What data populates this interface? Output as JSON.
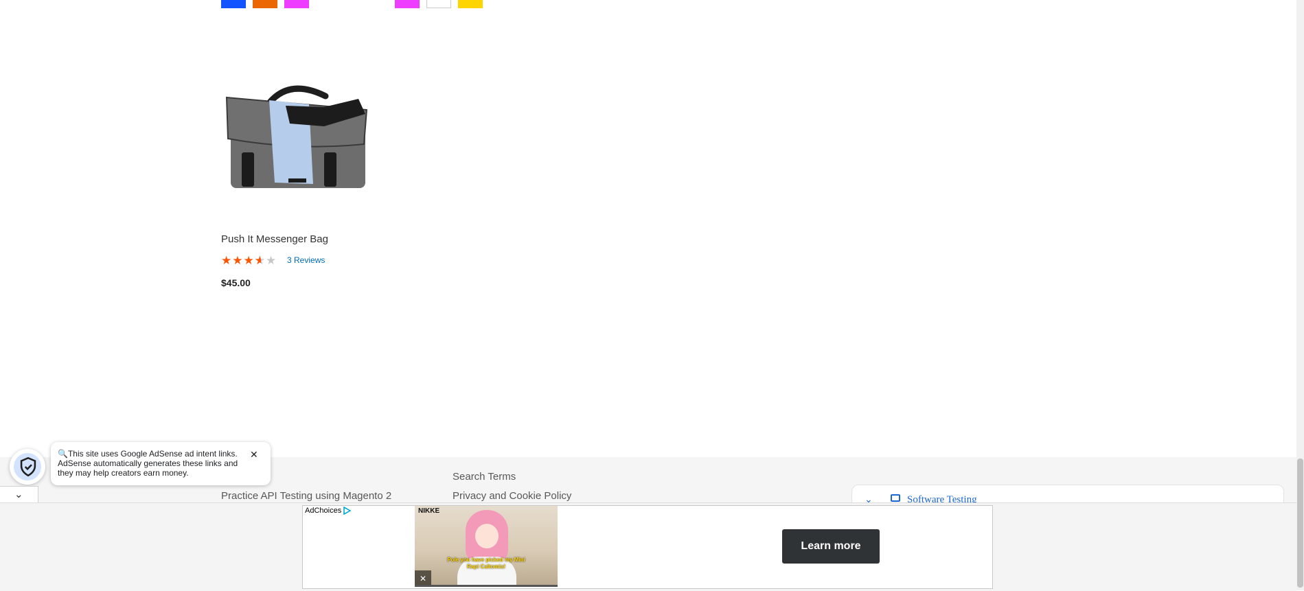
{
  "colors": {
    "swatches": [
      "#1254ff",
      "#eb6703",
      "#ef3dff",
      "#ef3dff",
      "#ffffff",
      "#ffd500"
    ],
    "star_on": "#ff5501",
    "star_off": "#c7c7c7",
    "link": "#006bb4",
    "learn_more_bg": "#303336"
  },
  "product": {
    "name": "Push It Messenger Bag",
    "rating_fraction": 0.6,
    "reviews_label": "3 Reviews",
    "price": "$45.00",
    "image_icon": "messenger-bag-photo"
  },
  "footer": {
    "links": [
      "Search Terms",
      "Privacy and Cookie Policy",
      "Practice API Testing using Magento 2"
    ],
    "widget_label": "Software Testing"
  },
  "adsense_notice": {
    "text": "🔍This site uses Google AdSense ad intent links. AdSense automatically generates these links and they may help creators earn money.",
    "close_icon": "close-icon"
  },
  "ad": {
    "adchoices_label": "AdChoices",
    "video_brand": "NIKKE",
    "video_caption": "Pole you have picked my Mini Rapi Caltomia!",
    "learn_more_label": "Learn more"
  }
}
